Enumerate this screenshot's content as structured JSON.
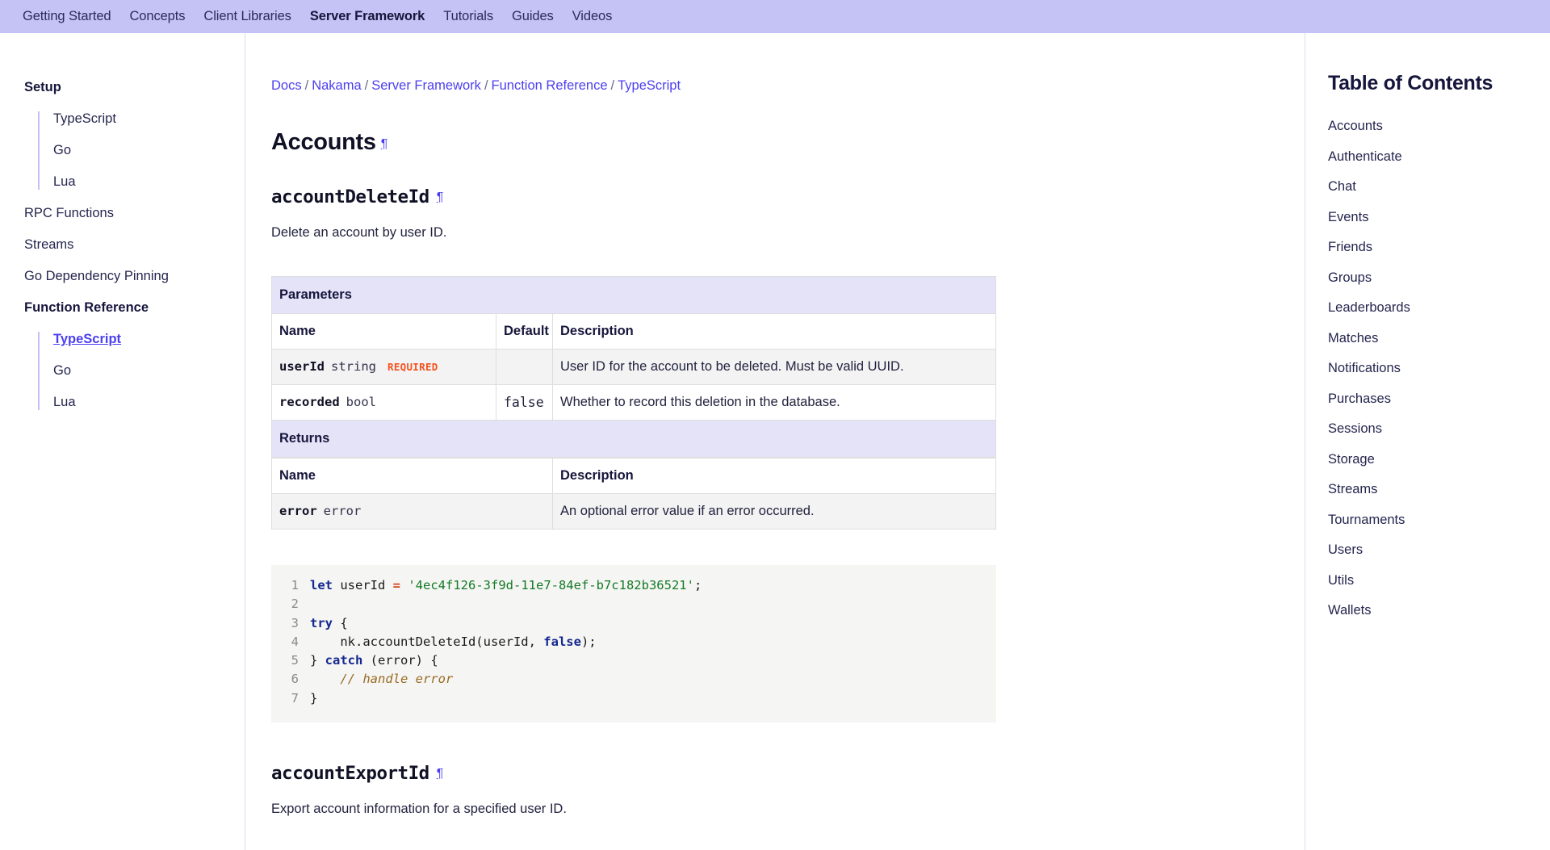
{
  "topnav": {
    "items": [
      {
        "label": "Getting Started",
        "active": false
      },
      {
        "label": "Concepts",
        "active": false
      },
      {
        "label": "Client Libraries",
        "active": false
      },
      {
        "label": "Server Framework",
        "active": true
      },
      {
        "label": "Tutorials",
        "active": false
      },
      {
        "label": "Guides",
        "active": false
      },
      {
        "label": "Videos",
        "active": false
      }
    ]
  },
  "sidebar": {
    "setup_title": "Setup",
    "setup_items": [
      "TypeScript",
      "Go",
      "Lua"
    ],
    "standalone_items": [
      "RPC Functions",
      "Streams",
      "Go Dependency Pinning"
    ],
    "funcref_title": "Function Reference",
    "funcref_items": [
      "TypeScript",
      "Go",
      "Lua"
    ],
    "funcref_current": "TypeScript"
  },
  "breadcrumb": {
    "items": [
      "Docs",
      "Nakama",
      "Server Framework",
      "Function Reference",
      "TypeScript"
    ],
    "separator": "/"
  },
  "main": {
    "page_title": "Accounts",
    "anchor_glyph": "¶",
    "sections": [
      {
        "name": "accountDeleteId",
        "description": "Delete an account by user ID.",
        "parameters": {
          "section_label": "Parameters",
          "headers": [
            "Name",
            "Default",
            "Description"
          ],
          "rows": [
            {
              "param": "userId",
              "type": "string",
              "required_badge": "REQUIRED",
              "default": "",
              "description": "User ID for the account to be deleted. Must be valid UUID."
            },
            {
              "param": "recorded",
              "type": "bool",
              "required_badge": "",
              "default": "false",
              "description": "Whether to record this deletion in the database."
            }
          ]
        },
        "returns": {
          "section_label": "Returns",
          "headers": [
            "Name",
            "Description"
          ],
          "rows": [
            {
              "param": "error",
              "type": "error",
              "description": "An optional error value if an error occurred."
            }
          ]
        },
        "code": {
          "language": "typescript",
          "lines": [
            {
              "n": "1",
              "tokens": [
                {
                  "t": "let",
                  "c": "kw"
                },
                {
                  "t": " userId ",
                  "c": "plain"
                },
                {
                  "t": "=",
                  "c": "op"
                },
                {
                  "t": " ",
                  "c": "plain"
                },
                {
                  "t": "'4ec4f126-3f9d-11e7-84ef-b7c182b36521'",
                  "c": "str"
                },
                {
                  "t": ";",
                  "c": "plain"
                }
              ]
            },
            {
              "n": "2",
              "tokens": []
            },
            {
              "n": "3",
              "tokens": [
                {
                  "t": "try",
                  "c": "kw"
                },
                {
                  "t": " {",
                  "c": "plain"
                }
              ]
            },
            {
              "n": "4",
              "tokens": [
                {
                  "t": "    nk.accountDeleteId(userId, ",
                  "c": "plain"
                },
                {
                  "t": "false",
                  "c": "kw"
                },
                {
                  "t": ");",
                  "c": "plain"
                }
              ]
            },
            {
              "n": "5",
              "tokens": [
                {
                  "t": "} ",
                  "c": "plain"
                },
                {
                  "t": "catch",
                  "c": "kw"
                },
                {
                  "t": " (error) {",
                  "c": "plain"
                }
              ]
            },
            {
              "n": "6",
              "tokens": [
                {
                  "t": "    // handle error",
                  "c": "cmt"
                }
              ]
            },
            {
              "n": "7",
              "tokens": [
                {
                  "t": "}",
                  "c": "plain"
                }
              ]
            }
          ]
        }
      },
      {
        "name": "accountExportId",
        "description": "Export account information for a specified user ID."
      }
    ]
  },
  "toc": {
    "title": "Table of Contents",
    "items": [
      "Accounts",
      "Authenticate",
      "Chat",
      "Events",
      "Friends",
      "Groups",
      "Leaderboards",
      "Matches",
      "Notifications",
      "Purchases",
      "Sessions",
      "Storage",
      "Streams",
      "Tournaments",
      "Users",
      "Utils",
      "Wallets"
    ]
  },
  "colors": {
    "nav_bg": "#c5c2f5",
    "link": "#4b3ff0",
    "required": "#f4511e",
    "table_section_bg": "#e5e3f7",
    "code_bg": "#f5f5f3",
    "keyword": "#15288f",
    "string": "#147a26",
    "operator": "#d6451f",
    "comment": "#9a6b25"
  }
}
